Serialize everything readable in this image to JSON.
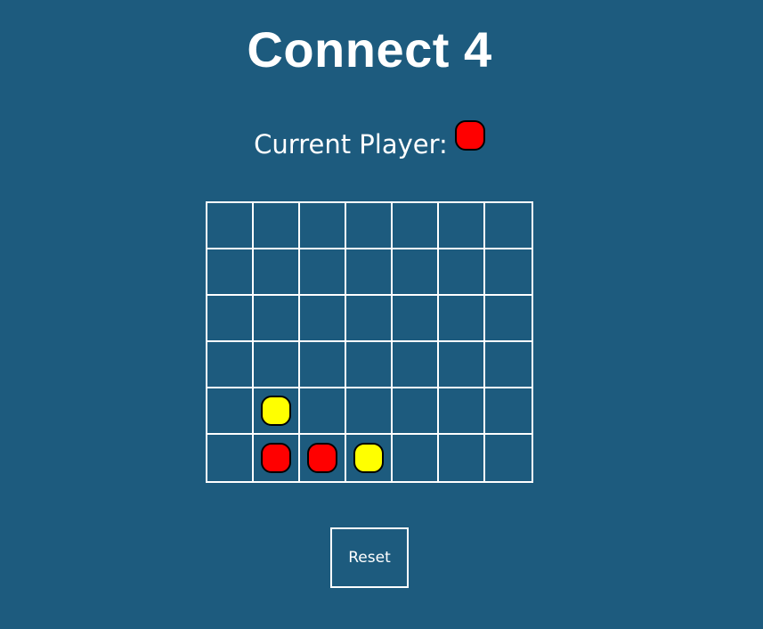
{
  "title": "Connect 4",
  "status": {
    "label": "Current Player:",
    "current_player": "red"
  },
  "colors": {
    "background": "#1d5b7e",
    "red": "#ff0000",
    "yellow": "#ffff00",
    "grid_line": "#ffffff"
  },
  "board": {
    "rows": 6,
    "cols": 7,
    "cells": [
      [
        "",
        "",
        "",
        "",
        "",
        "",
        ""
      ],
      [
        "",
        "",
        "",
        "",
        "",
        "",
        ""
      ],
      [
        "",
        "",
        "",
        "",
        "",
        "",
        ""
      ],
      [
        "",
        "",
        "",
        "",
        "",
        "",
        ""
      ],
      [
        "",
        "yellow",
        "",
        "",
        "",
        "",
        ""
      ],
      [
        "",
        "red",
        "red",
        "yellow",
        "",
        "",
        ""
      ]
    ]
  },
  "reset_label": "Reset"
}
